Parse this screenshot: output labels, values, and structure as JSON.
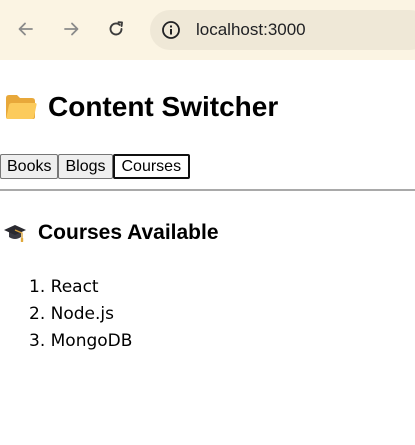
{
  "browser": {
    "url": "localhost:3000",
    "icons": {
      "back": "arrow-left-icon",
      "forward": "arrow-right-icon",
      "reload": "reload-icon",
      "site_info": "info-icon"
    }
  },
  "page": {
    "title": "Content Switcher",
    "title_icon": "folder-icon",
    "tabs": [
      {
        "label": "Books",
        "active": false
      },
      {
        "label": "Blogs",
        "active": false
      },
      {
        "label": "Courses",
        "active": true
      }
    ],
    "section": {
      "title": "Courses Available",
      "icon": "graduation-cap-icon",
      "items": [
        {
          "number": "1.",
          "text": "React"
        },
        {
          "number": "2.",
          "text": "Node.js"
        },
        {
          "number": "3.",
          "text": "MongoDB"
        }
      ]
    }
  },
  "colors": {
    "chrome_bg": "#fbf4e3",
    "omnibox_bg": "#efe8d7"
  }
}
